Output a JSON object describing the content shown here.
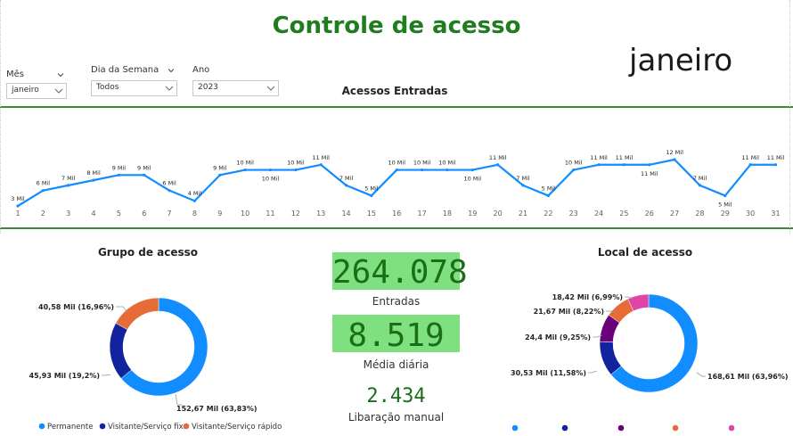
{
  "header": {
    "title": "Controle de acesso",
    "month_display": "janeiro"
  },
  "filters": {
    "mes": {
      "label": "Mês",
      "value": "janeiro"
    },
    "dia_semana": {
      "label": "Dia da Semana",
      "value": "Todos"
    },
    "ano": {
      "label": "Ano",
      "value": "2023"
    }
  },
  "kpis": {
    "entradas": {
      "value": "264.078",
      "caption": "Entradas"
    },
    "media_diaria": {
      "value": "8.519",
      "caption": "Média diária"
    },
    "liberacao": {
      "value": "2.434",
      "caption": "Libaração manual"
    }
  },
  "colors": {
    "line": "#118dff",
    "title_green": "#1f7d1f",
    "kpi_bg": "#7fe07f",
    "kpi_text": "#1a6e1a",
    "blue": "#118dff",
    "navy": "#12239e",
    "orange": "#e66c37",
    "purple": "#6b007b",
    "pink": "#e044a7"
  },
  "chart_data": [
    {
      "type": "line",
      "title": "Acessos Entradas",
      "x": [
        1,
        2,
        3,
        4,
        5,
        6,
        7,
        8,
        9,
        10,
        11,
        12,
        13,
        14,
        15,
        16,
        17,
        18,
        19,
        20,
        21,
        22,
        23,
        24,
        25,
        26,
        27,
        28,
        29,
        30,
        31
      ],
      "values": [
        3,
        6,
        7,
        8,
        9,
        9,
        6,
        4,
        9,
        10,
        10,
        10,
        11,
        7,
        5,
        10,
        10,
        10,
        10,
        11,
        7,
        5,
        10,
        11,
        11,
        11,
        12,
        7,
        5,
        11,
        11
      ],
      "data_labels": [
        "3 Mil",
        "6 Mil",
        "7 Mil",
        "8 Mil",
        "9 Mil",
        "9 Mil",
        "6 Mil",
        "4 Mil",
        "9 Mil",
        "10 Mil",
        "10 Mil",
        "10 Mil",
        "11 Mil",
        "7 Mil",
        "5 Mil",
        "10 Mil",
        "10 Mil",
        "10 Mil",
        "10 Mil",
        "11 Mil",
        "7 Mil",
        "5 Mil",
        "10 Mil",
        "11 Mil",
        "11 Mil",
        "11 Mil",
        "12 Mil",
        "7 Mil",
        "5 Mil",
        "11 Mil",
        "11 Mil"
      ],
      "label_below": [
        11,
        19,
        26,
        29
      ],
      "grid": false
    },
    {
      "type": "pie",
      "title": "Grupo de acesso",
      "slices": [
        {
          "name": "Permanente",
          "value": 152.67,
          "label": "152,67 Mil (63,83%)",
          "color": "#118dff"
        },
        {
          "name": "Visitante/Serviço fixo",
          "value": 45.93,
          "label": "45,93 Mil (19,2%)",
          "color": "#12239e"
        },
        {
          "name": "Visitante/Serviço rápido",
          "value": 40.58,
          "label": "40,58 Mil (16,96%)",
          "color": "#e66c37"
        }
      ],
      "legend": "bottom"
    },
    {
      "type": "pie",
      "title": "Local de acesso",
      "slices": [
        {
          "value": 168.61,
          "label": "168,61 Mil (63,96%)",
          "color": "#118dff"
        },
        {
          "value": 30.53,
          "label": "30,53 Mil (11,58%)",
          "color": "#12239e"
        },
        {
          "value": 24.4,
          "label": "24,4 Mil (9,25%)",
          "color": "#6b007b"
        },
        {
          "value": 21.67,
          "label": "21,67 Mil (8,22%)",
          "color": "#e66c37"
        },
        {
          "value": 18.42,
          "label": "18,42 Mil (6,99%)",
          "color": "#e044a7"
        }
      ],
      "legend": "bottom"
    }
  ]
}
